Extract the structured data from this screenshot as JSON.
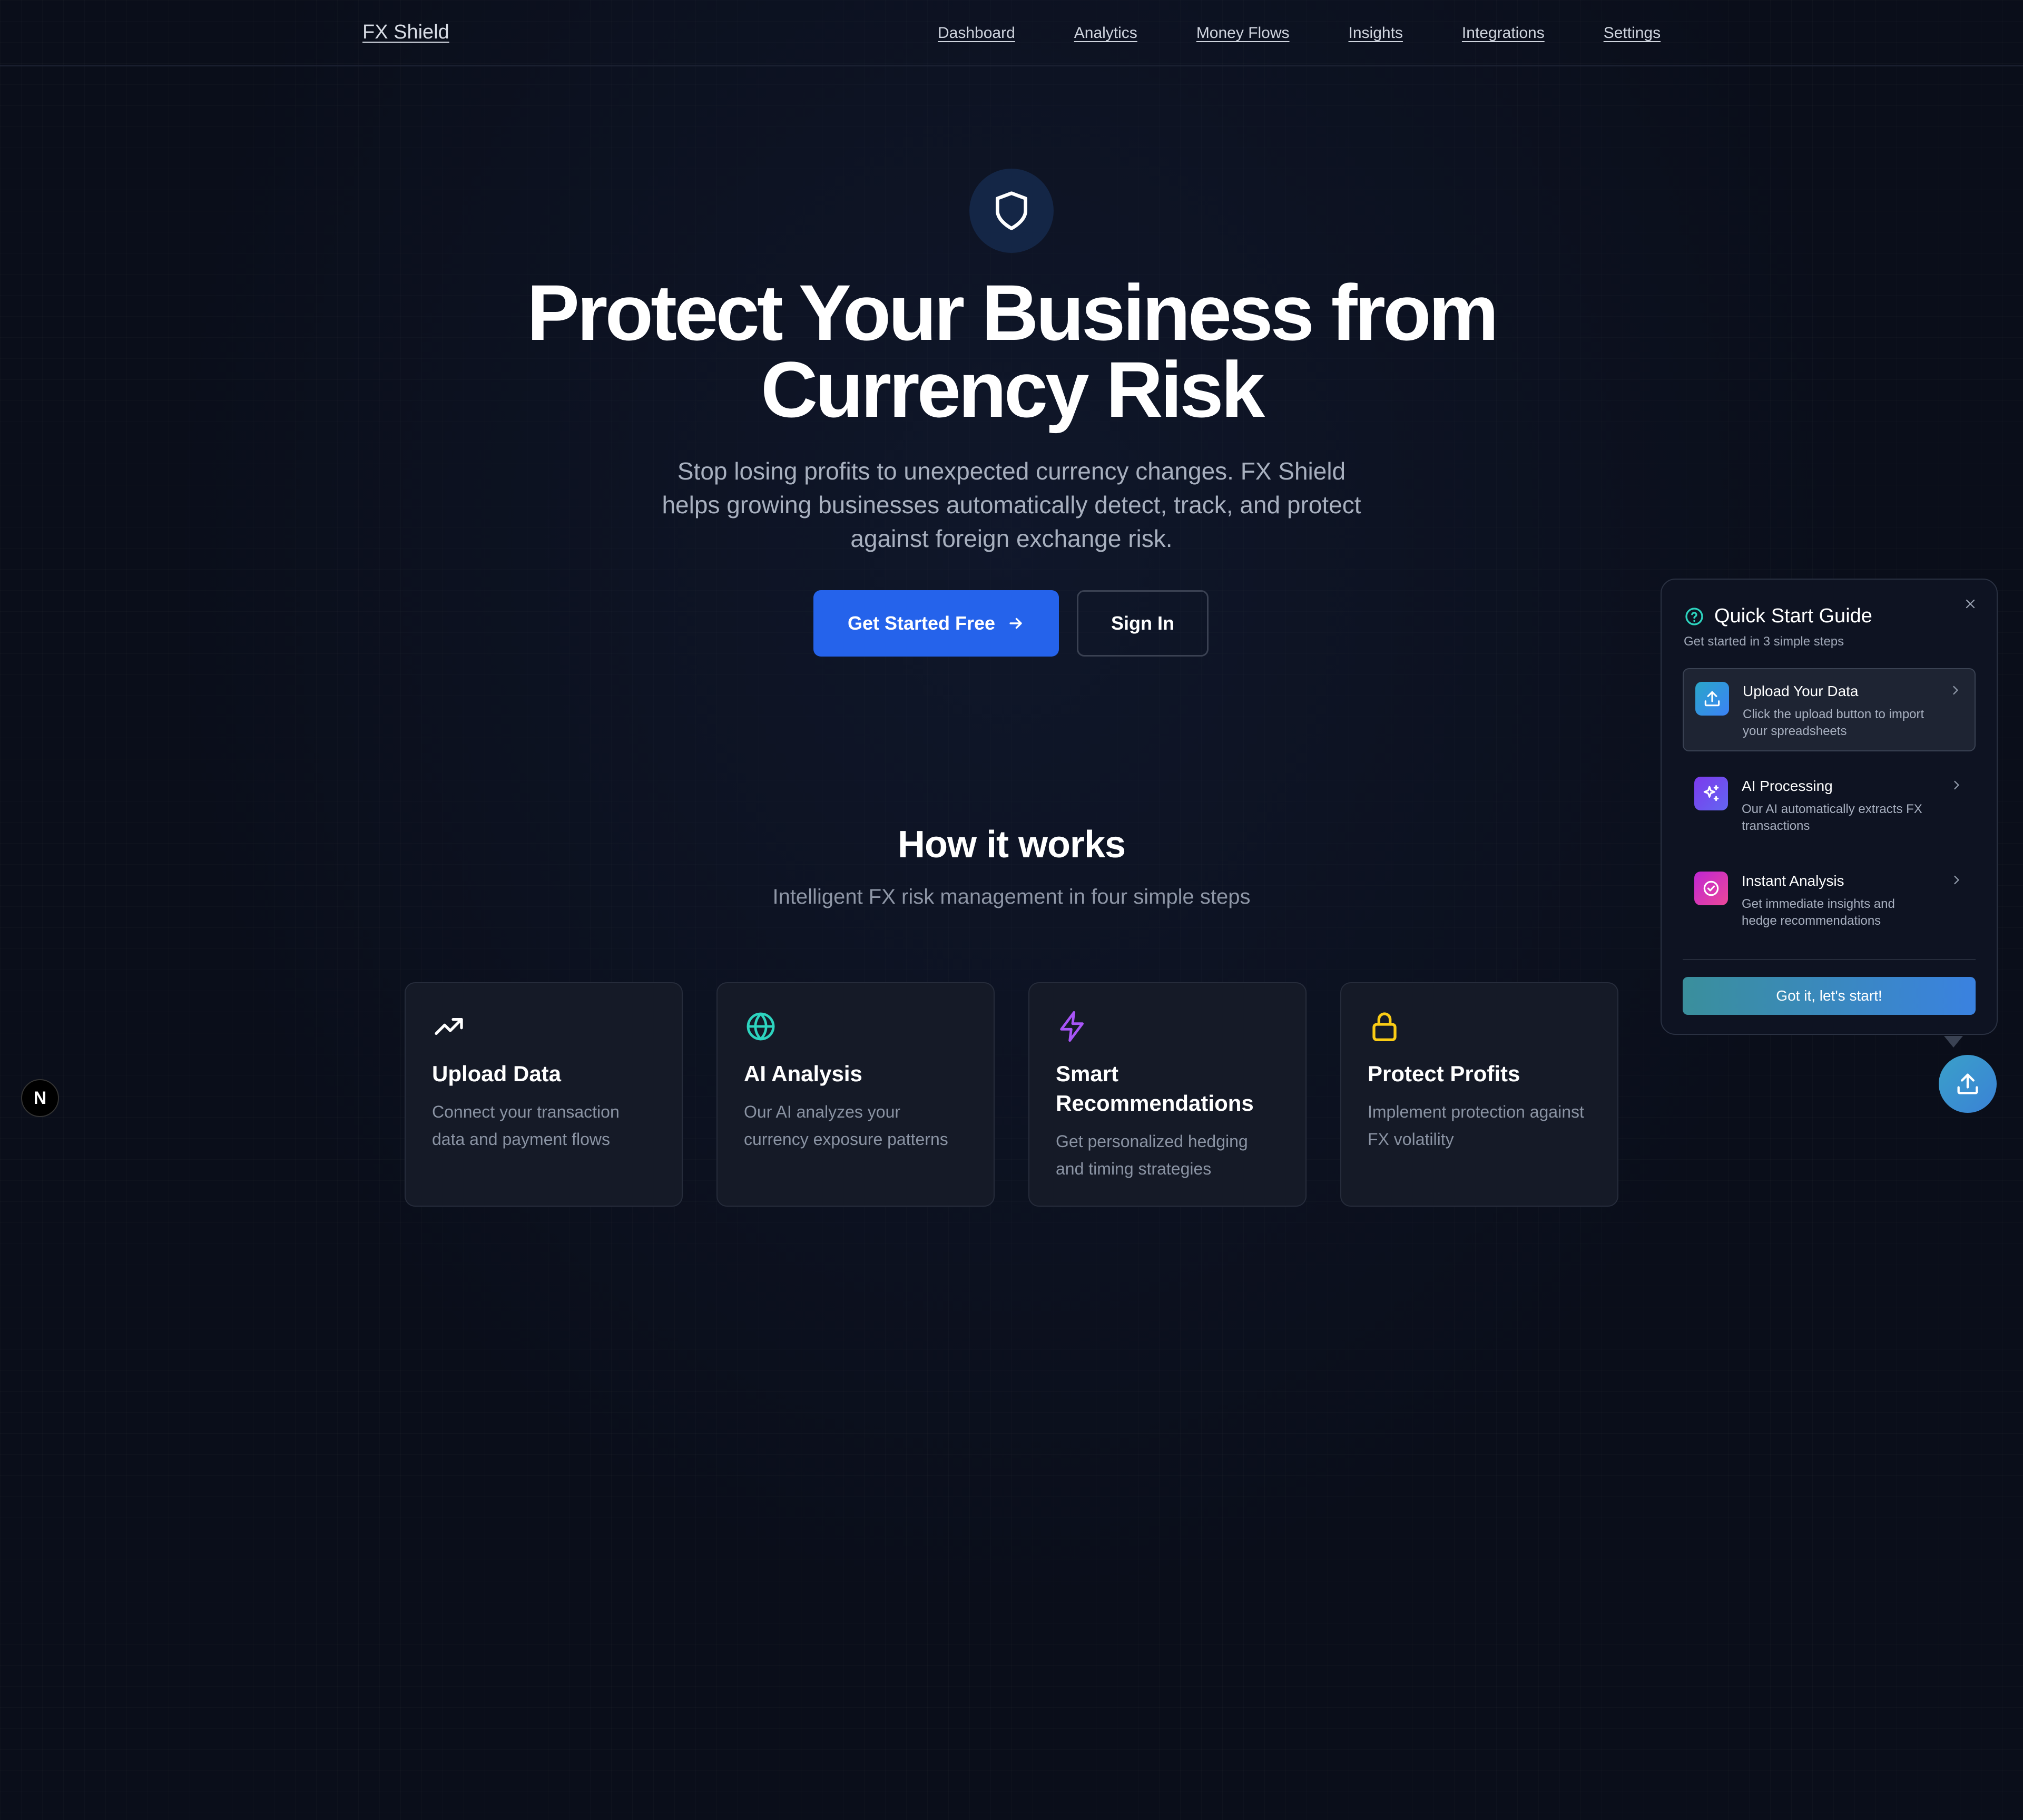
{
  "nav": {
    "brand": "FX Shield",
    "links": [
      "Dashboard",
      "Analytics",
      "Money Flows",
      "Insights",
      "Integrations",
      "Settings"
    ]
  },
  "hero": {
    "icon": "shield-icon",
    "title": "Protect Your Business from Currency Risk",
    "subtitle": "Stop losing profits to unexpected currency changes. FX Shield helps growing businesses automatically detect, track, and protect against foreign exchange risk.",
    "primary_button": "Get Started Free",
    "secondary_button": "Sign In"
  },
  "how_it_works": {
    "title": "How it works",
    "subtitle": "Intelligent FX risk management in four simple steps",
    "cards": [
      {
        "icon": "trending-up-icon",
        "title": "Upload Data",
        "description": "Connect your transaction data and payment flows",
        "color": "#ffffff"
      },
      {
        "icon": "globe-icon",
        "title": "AI Analysis",
        "description": "Our AI analyzes your currency exposure patterns",
        "color": "#2dd4bf"
      },
      {
        "icon": "lightning-icon",
        "title": "Smart Recommendations",
        "description": "Get personalized hedging and timing strategies",
        "color": "#a855f7"
      },
      {
        "icon": "lock-icon",
        "title": "Protect Profits",
        "description": "Implement protection against FX volatility",
        "color": "#facc15"
      }
    ]
  },
  "quick_start": {
    "title": "Quick Start Guide",
    "subtitle": "Get started in 3 simple steps",
    "steps": [
      {
        "icon": "upload-icon",
        "title": "Upload Your Data",
        "description": "Click the upload button to import your spreadsheets"
      },
      {
        "icon": "sparkles-icon",
        "title": "AI Processing",
        "description": "Our AI automatically extracts FX transactions"
      },
      {
        "icon": "check-circle-icon",
        "title": "Instant Analysis",
        "description": "Get immediate insights and hedge recommendations"
      }
    ],
    "cta": "Got it, let's start!"
  },
  "badge": {
    "label": "N"
  },
  "colors": {
    "background": "#0a0e1a",
    "primary": "#2563eb",
    "card": "#151a27"
  }
}
